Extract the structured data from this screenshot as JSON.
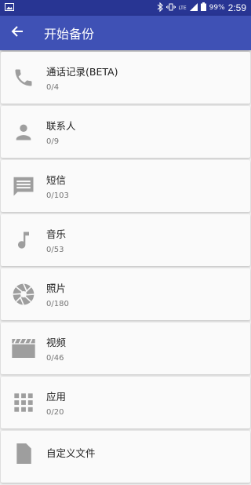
{
  "status_bar": {
    "battery_percent": "99%",
    "time": "2:59",
    "network": "LTE"
  },
  "app_bar": {
    "title": "开始备份"
  },
  "items": [
    {
      "title": "通话记录(BETA)",
      "count": "0/4",
      "icon": "phone-icon"
    },
    {
      "title": "联系人",
      "count": "0/9",
      "icon": "person-icon"
    },
    {
      "title": "短信",
      "count": "0/103",
      "icon": "message-icon"
    },
    {
      "title": "音乐",
      "count": "0/53",
      "icon": "music-note-icon"
    },
    {
      "title": "照片",
      "count": "0/180",
      "icon": "camera-shutter-icon"
    },
    {
      "title": "视频",
      "count": "0/46",
      "icon": "clapperboard-icon"
    },
    {
      "title": "应用",
      "count": "0/20",
      "icon": "apps-grid-icon"
    },
    {
      "title": "自定义文件",
      "count": "",
      "icon": "file-icon"
    }
  ],
  "colors": {
    "status_bar": "#283593",
    "app_bar": "#3f51b5",
    "icon": "#9e9e9e"
  }
}
